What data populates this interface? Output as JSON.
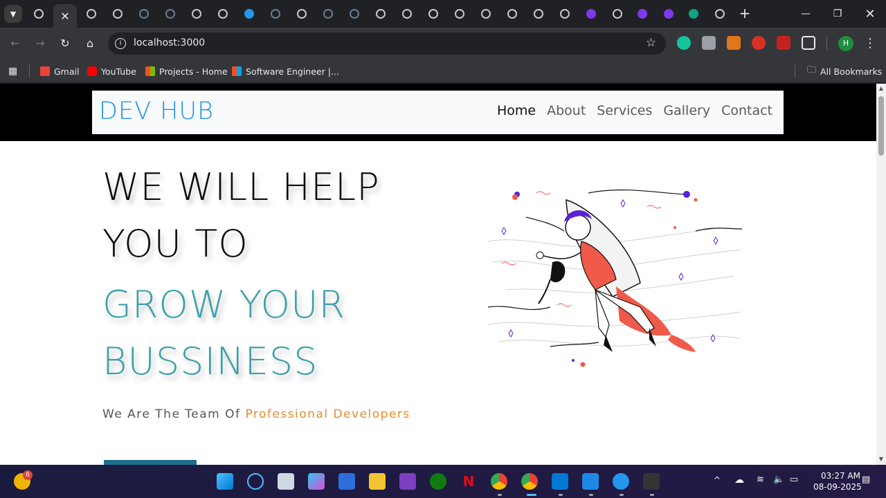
{
  "browser": {
    "address": "localhost:3000",
    "bookmarks": [
      {
        "label": "Gmail"
      },
      {
        "label": "YouTube"
      },
      {
        "label": "Projects - Home"
      },
      {
        "label": "Software Engineer |..."
      }
    ],
    "all_bookmarks": "All Bookmarks",
    "profile_initial": "H"
  },
  "site": {
    "brand": "DEV HUB",
    "nav": [
      "Home",
      "About",
      "Services",
      "Gallery",
      "Contact"
    ],
    "hero": {
      "line1": "WE WILL HELP",
      "line2": "YOU TO",
      "line3": "GROW YOUR",
      "line4": "BUSSINESS"
    },
    "tagline_prefix": "We Are The Team Of",
    "tagline_accent": "Professional Developers"
  },
  "taskbar": {
    "weather_badge": "6",
    "time": "03:27 AM",
    "date": "08-09-2025"
  },
  "colors": {
    "brand": "#2196d8",
    "teal": "#3aa1aa",
    "accent": "#e8892b"
  }
}
